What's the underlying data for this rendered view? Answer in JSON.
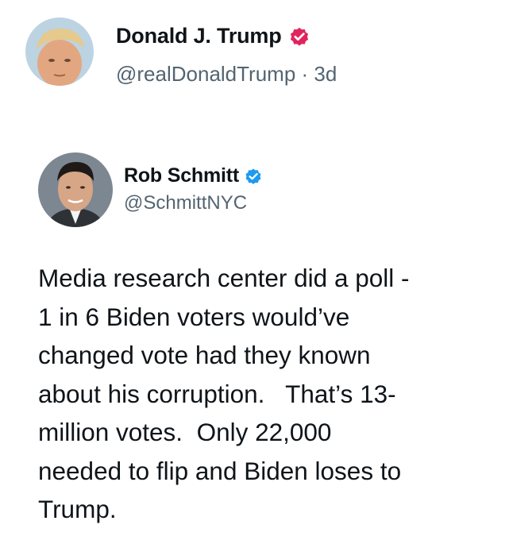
{
  "tweet": {
    "author": {
      "display_name": "Donald J. Trump",
      "handle": "@realDonaldTrump",
      "separator": "·",
      "age": "3d",
      "verified_badge_color": "#e0245e"
    }
  },
  "quoted": {
    "author": {
      "display_name": "Rob Schmitt",
      "handle": "@SchmittNYC",
      "verified_badge_color": "#1d9bf0"
    },
    "text_lines": [
      "Media research center did a poll -",
      "1 in 6 Biden voters would’ve",
      "changed vote had they known",
      "about his corruption.   That’s 13-",
      "million votes.  Only 22,000",
      "needed to flip and Biden loses to",
      "Trump."
    ]
  }
}
